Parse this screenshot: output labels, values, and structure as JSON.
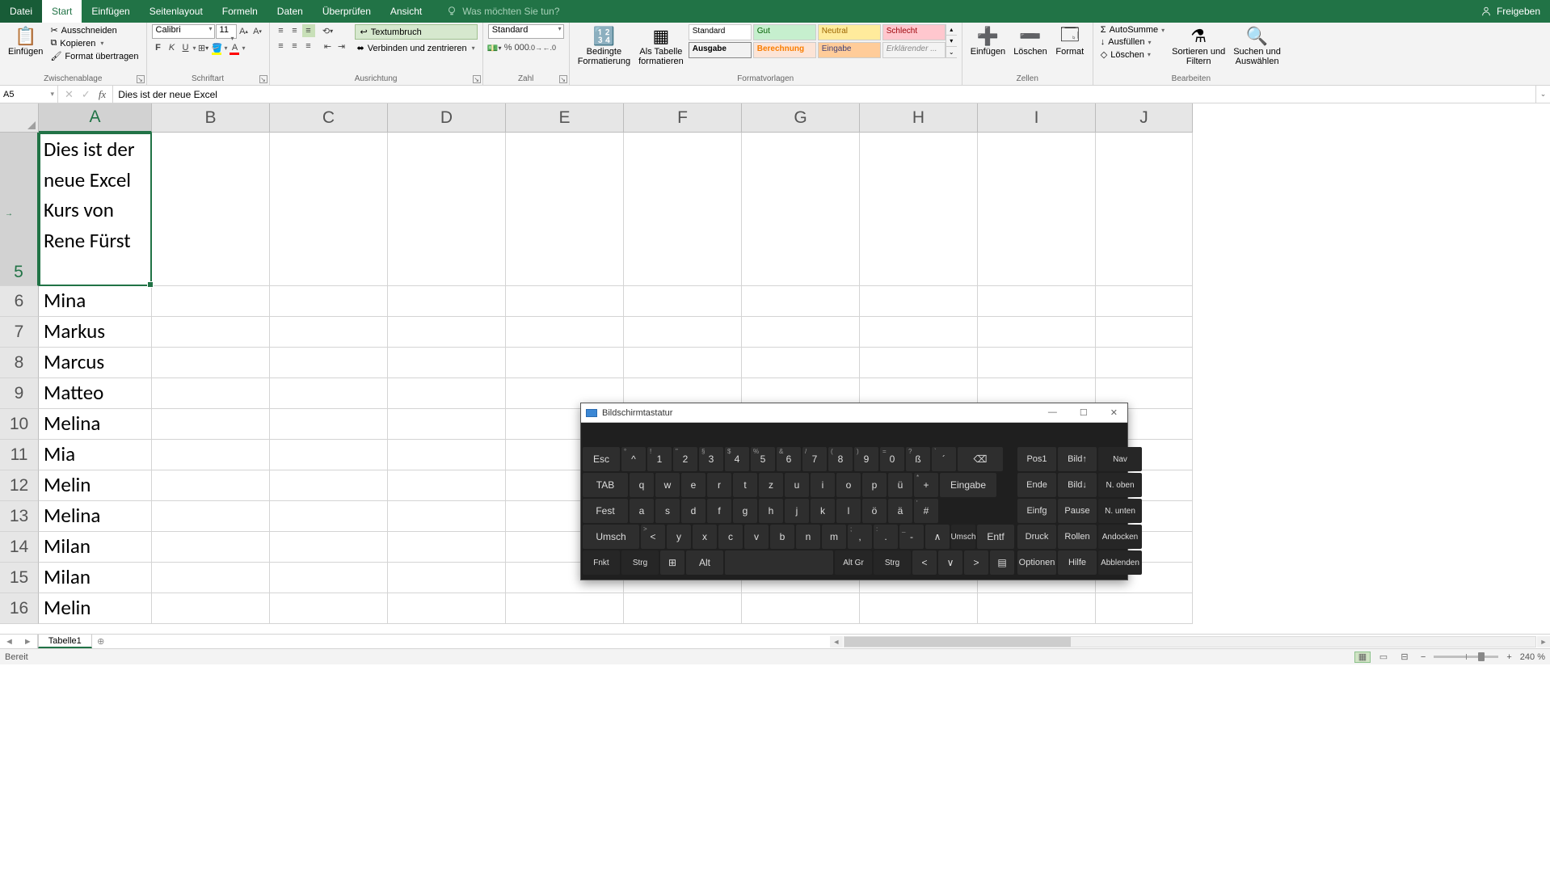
{
  "title_tabs": {
    "file": "Datei",
    "home": "Start",
    "insert": "Einfügen",
    "page_layout": "Seitenlayout",
    "formulas": "Formeln",
    "data": "Daten",
    "review": "Überprüfen",
    "view": "Ansicht",
    "tell_me": "Was möchten Sie tun?",
    "share": "Freigeben"
  },
  "ribbon": {
    "clipboard": {
      "paste": "Einfügen",
      "cut": "Ausschneiden",
      "copy": "Kopieren",
      "fmt_painter": "Format übertragen",
      "label": "Zwischenablage"
    },
    "font": {
      "name": "Calibri",
      "size": "11",
      "bold": "F",
      "italic": "K",
      "underline": "U",
      "label": "Schriftart"
    },
    "alignment": {
      "wrap": "Textumbruch",
      "merge": "Verbinden und zentrieren",
      "label": "Ausrichtung"
    },
    "number": {
      "format": "Standard",
      "label": "Zahl"
    },
    "styles": {
      "cond_fmt": "Bedingte\nFormatierung",
      "as_table": "Als Tabelle\nformatieren",
      "standard": "Standard",
      "gut": "Gut",
      "neutral": "Neutral",
      "schlecht": "Schlecht",
      "ausgabe": "Ausgabe",
      "berechnung": "Berechnung",
      "eingabe": "Eingabe",
      "erklar": "Erklärender ...",
      "label": "Formatvorlagen"
    },
    "cells": {
      "insert": "Einfügen",
      "delete": "Löschen",
      "format": "Format",
      "label": "Zellen"
    },
    "editing": {
      "autosum": "AutoSumme",
      "fill": "Ausfüllen",
      "clear": "Löschen",
      "sort": "Sortieren und\nFiltern",
      "find": "Suchen und\nAuswählen",
      "label": "Bearbeiten"
    }
  },
  "name_box": "A5",
  "formula_bar": "Dies ist der neue Excel",
  "columns": [
    "A",
    "B",
    "C",
    "D",
    "E",
    "F",
    "G",
    "H",
    "I",
    "J"
  ],
  "active_cell": {
    "col": "A",
    "row": 5
  },
  "rows": [
    {
      "num": "5",
      "tall": true,
      "cells": [
        "Dies ist der neue Excel Kurs von Rene Fürst",
        "",
        "",
        "",
        "",
        "",
        "",
        "",
        "",
        ""
      ]
    },
    {
      "num": "6",
      "cells": [
        "Mina",
        "",
        "",
        "",
        "",
        "",
        "",
        "",
        "",
        ""
      ]
    },
    {
      "num": "7",
      "cells": [
        "Markus",
        "",
        "",
        "",
        "",
        "",
        "",
        "",
        "",
        ""
      ]
    },
    {
      "num": "8",
      "cells": [
        "Marcus",
        "",
        "",
        "",
        "",
        "",
        "",
        "",
        "",
        ""
      ]
    },
    {
      "num": "9",
      "cells": [
        "Matteo",
        "",
        "",
        "",
        "",
        "",
        "",
        "",
        "",
        ""
      ]
    },
    {
      "num": "10",
      "cells": [
        "Melina",
        "",
        "",
        "",
        "",
        "",
        "",
        "",
        "",
        ""
      ]
    },
    {
      "num": "11",
      "cells": [
        "Mia",
        "",
        "",
        "",
        "",
        "",
        "",
        "",
        "",
        ""
      ]
    },
    {
      "num": "12",
      "cells": [
        "Melin",
        "",
        "",
        "",
        "",
        "",
        "",
        "",
        "",
        ""
      ]
    },
    {
      "num": "13",
      "cells": [
        "Melina",
        "",
        "",
        "",
        "",
        "",
        "",
        "",
        "",
        ""
      ]
    },
    {
      "num": "14",
      "cells": [
        "Milan",
        "",
        "",
        "",
        "",
        "",
        "",
        "",
        "",
        ""
      ]
    },
    {
      "num": "15",
      "cells": [
        "Milan",
        "",
        "",
        "",
        "",
        "",
        "",
        "",
        "",
        ""
      ]
    },
    {
      "num": "16",
      "cells": [
        "Melin",
        "",
        "",
        "",
        "",
        "",
        "",
        "",
        "",
        ""
      ]
    }
  ],
  "sheet_tab": "Tabelle1",
  "status": {
    "ready": "Bereit",
    "zoom": "240 %"
  },
  "osk": {
    "title": "Bildschirmtastatur",
    "row1": [
      {
        "l": "Esc",
        "w": "w15"
      },
      {
        "l": "^",
        "sup": "°",
        "w": "w1"
      },
      {
        "l": "1",
        "sup": "!",
        "w": "w1"
      },
      {
        "l": "2",
        "sup": "\"",
        "w": "w1"
      },
      {
        "l": "3",
        "sup": "§",
        "w": "w1"
      },
      {
        "l": "4",
        "sup": "$",
        "w": "w1"
      },
      {
        "l": "5",
        "sup": "%",
        "w": "w1"
      },
      {
        "l": "6",
        "sup": "&",
        "w": "w1"
      },
      {
        "l": "7",
        "sup": "/",
        "w": "w1"
      },
      {
        "l": "8",
        "sup": "(",
        "w": "w1"
      },
      {
        "l": "9",
        "sup": ")",
        "w": "w1"
      },
      {
        "l": "0",
        "sup": "=",
        "w": "w1"
      },
      {
        "l": "ß",
        "sup": "?",
        "w": "w1"
      },
      {
        "l": "´",
        "sup": "`",
        "w": "w1"
      },
      {
        "l": "⌫",
        "w": "w2"
      }
    ],
    "row2": [
      {
        "l": "TAB",
        "w": "w2"
      },
      {
        "l": "q",
        "w": "w1"
      },
      {
        "l": "w",
        "w": "w1"
      },
      {
        "l": "e",
        "w": "w1"
      },
      {
        "l": "r",
        "w": "w1"
      },
      {
        "l": "t",
        "w": "w1"
      },
      {
        "l": "z",
        "w": "w1"
      },
      {
        "l": "u",
        "w": "w1"
      },
      {
        "l": "i",
        "w": "w1"
      },
      {
        "l": "o",
        "w": "w1"
      },
      {
        "l": "p",
        "w": "w1"
      },
      {
        "l": "ü",
        "w": "w1"
      },
      {
        "l": "+",
        "sup": "*",
        "w": "w1"
      },
      {
        "l": "Eingabe",
        "w": "w25"
      }
    ],
    "row3": [
      {
        "l": "Fest",
        "w": "w2"
      },
      {
        "l": "a",
        "w": "w1"
      },
      {
        "l": "s",
        "w": "w1"
      },
      {
        "l": "d",
        "w": "w1"
      },
      {
        "l": "f",
        "w": "w1"
      },
      {
        "l": "g",
        "w": "w1"
      },
      {
        "l": "h",
        "w": "w1"
      },
      {
        "l": "j",
        "w": "w1"
      },
      {
        "l": "k",
        "w": "w1"
      },
      {
        "l": "l",
        "w": "w1"
      },
      {
        "l": "ö",
        "w": "w1"
      },
      {
        "l": "ä",
        "w": "w1"
      },
      {
        "l": "#",
        "sup": "'",
        "w": "w1"
      }
    ],
    "row4": [
      {
        "l": "Umsch",
        "w": "w25"
      },
      {
        "l": "<",
        "sup": ">",
        "w": "w1"
      },
      {
        "l": "y",
        "w": "w1"
      },
      {
        "l": "x",
        "w": "w1"
      },
      {
        "l": "c",
        "w": "w1"
      },
      {
        "l": "v",
        "w": "w1"
      },
      {
        "l": "b",
        "w": "w1"
      },
      {
        "l": "n",
        "w": "w1"
      },
      {
        "l": "m",
        "w": "w1"
      },
      {
        "l": ",",
        "sup": ";",
        "w": "w1"
      },
      {
        "l": ".",
        "sup": ":",
        "w": "w1"
      },
      {
        "l": "-",
        "sup": "_",
        "w": "w1"
      },
      {
        "l": "∧",
        "w": "w1"
      },
      {
        "l": "Umsch",
        "w": "w1",
        "small": true
      },
      {
        "l": "Entf",
        "w": "w15"
      }
    ],
    "row5": [
      {
        "l": "Fnkt",
        "w": "w15",
        "small": true
      },
      {
        "l": "Strg",
        "w": "w15",
        "small": true
      },
      {
        "l": "⊞",
        "w": "w1"
      },
      {
        "l": "Alt",
        "w": "w15"
      },
      {
        "l": "",
        "w": "space"
      },
      {
        "l": "Alt Gr",
        "w": "w15",
        "small": true
      },
      {
        "l": "Strg",
        "w": "w15",
        "small": true
      },
      {
        "l": "<",
        "w": "w1"
      },
      {
        "l": "∨",
        "w": "w1"
      },
      {
        "l": ">",
        "w": "w1"
      },
      {
        "l": "▤",
        "w": "w1"
      }
    ],
    "side": [
      [
        "Pos1",
        "Bild↑",
        "Nav"
      ],
      [
        "Ende",
        "Bild↓",
        "N. oben"
      ],
      [
        "Einfg",
        "Pause",
        "N. unten"
      ],
      [
        "Druck",
        "Rollen",
        "Andocken"
      ],
      [
        "Optionen",
        "Hilfe",
        "Abblenden"
      ]
    ]
  }
}
